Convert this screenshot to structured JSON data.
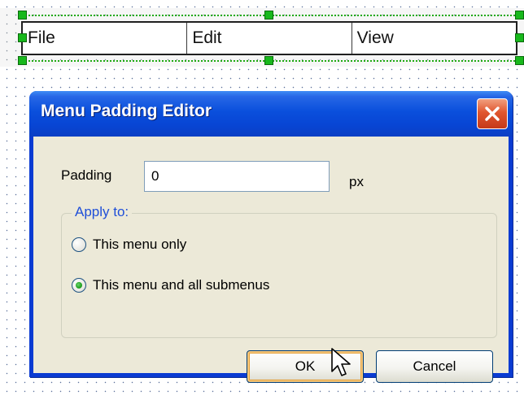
{
  "menu_bar": {
    "items": [
      {
        "label": "File"
      },
      {
        "label": "Edit"
      },
      {
        "label": "View"
      }
    ]
  },
  "dialog": {
    "title": "Menu Padding Editor",
    "padding_label": "Padding",
    "padding_value": "0",
    "padding_unit": "px",
    "group_label": "Apply to:",
    "options": [
      {
        "label": "This menu only",
        "selected": false
      },
      {
        "label": "This menu and all submenus",
        "selected": true
      }
    ],
    "ok_label": "OK",
    "cancel_label": "Cancel"
  },
  "colors": {
    "titlebar": "#0a4fdc",
    "client_background": "#ece9d8",
    "selection_handle": "#18b81c",
    "close_button": "#e0562f",
    "group_label_text": "#1f4fd8",
    "radio_dot": "#21a121"
  },
  "icons": {
    "close": "close-icon",
    "cursor": "mouse-pointer-icon"
  }
}
